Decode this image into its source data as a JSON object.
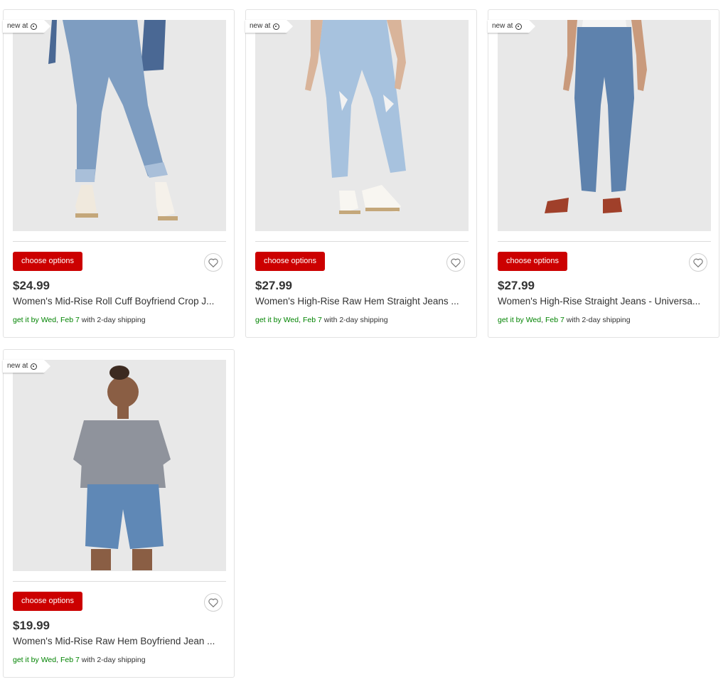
{
  "products": [
    {
      "badge": "new at",
      "button_label": "choose options",
      "price": "$24.99",
      "title": "Women's Mid-Rise Roll Cuff Boyfriend Crop J...",
      "ship_prefix": "get it by ",
      "ship_day": "Wed",
      "ship_sep": ", ",
      "ship_date": "Feb 7",
      "ship_suffix": " with 2-day shipping"
    },
    {
      "badge": "new at",
      "button_label": "choose options",
      "price": "$27.99",
      "title": "Women's High-Rise Raw Hem Straight Jeans ...",
      "ship_prefix": "get it by ",
      "ship_day": "Wed",
      "ship_sep": ", ",
      "ship_date": "Feb 7",
      "ship_suffix": " with 2-day shipping"
    },
    {
      "badge": "new at",
      "button_label": "choose options",
      "price": "$27.99",
      "title": "Women's High-Rise Straight Jeans - Universa...",
      "ship_prefix": "get it by ",
      "ship_day": "Wed",
      "ship_sep": ", ",
      "ship_date": "Feb 7",
      "ship_suffix": " with 2-day shipping"
    },
    {
      "badge": "new at",
      "button_label": "choose options",
      "price": "$19.99",
      "title": "Women's Mid-Rise Raw Hem Boyfriend Jean ...",
      "ship_prefix": "get it by ",
      "ship_day": "Wed",
      "ship_sep": ", ",
      "ship_date": "Feb 7",
      "ship_suffix": " with 2-day shipping"
    }
  ],
  "colors": {
    "button": "#cc0000",
    "shipping_green": "#008300",
    "denim": "#6f8fb3"
  },
  "icons": [
    "target-bullseye-icon",
    "heart-icon"
  ]
}
